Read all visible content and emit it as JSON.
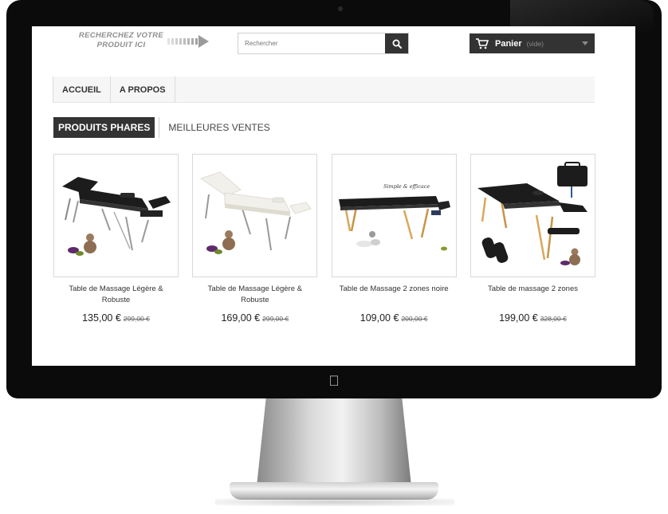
{
  "header": {
    "tagline_line1": "Recherchez votre",
    "tagline_line2": "produit ici",
    "search_placeholder": "Rechercher",
    "cart_label": "Panier",
    "cart_status": "(vide)"
  },
  "nav": {
    "items": [
      {
        "label": "ACCUEIL"
      },
      {
        "label": "A PROPOS"
      }
    ]
  },
  "tabs": [
    {
      "label": "PRODUITS PHARES",
      "active": true
    },
    {
      "label": "MEILLEURES VENTES",
      "active": false
    }
  ],
  "products": [
    {
      "name": "Table de Massage Légère & Robuste",
      "price": "135,00 €",
      "old_price": "299,00 €",
      "color": "#1c1c1c"
    },
    {
      "name": "Table de Massage Légère & Robuste",
      "price": "169,00 €",
      "old_price": "299,00 €",
      "color": "#f2f0ea"
    },
    {
      "name": "Table de Massage 2 zones noire",
      "price": "109,00 €",
      "old_price": "200,00 €",
      "color": "#1c1c1c",
      "image_caption": "Simple & efficace"
    },
    {
      "name": "Table de massage 2 zones",
      "price": "199,00 €",
      "old_price": "328,00 €",
      "color": "#1c1c1c"
    }
  ],
  "colors": {
    "dark": "#333333",
    "nav_bg": "#f6f6f6",
    "tagline": "#8e8e8e"
  }
}
